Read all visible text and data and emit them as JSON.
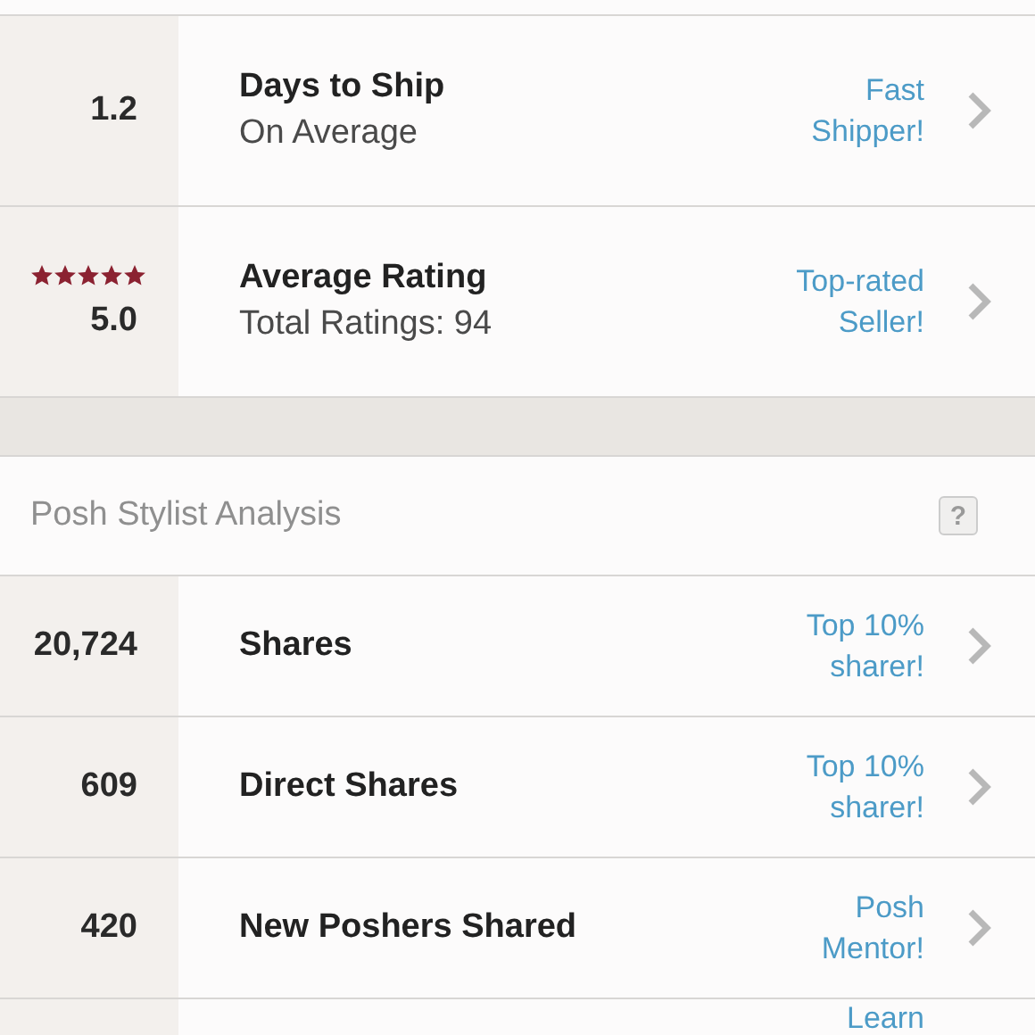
{
  "sections": [
    {
      "kind": "metrics",
      "rows": [
        {
          "value": "1.2",
          "label": "Days to Ship",
          "sublabel": "On Average",
          "badge": [
            "Fast",
            "Shipper!"
          ]
        },
        {
          "value": "5.0",
          "stars": 5,
          "label": "Average Rating",
          "sublabel": "Total Ratings: 94",
          "badge": [
            "Top-rated",
            "Seller!"
          ]
        }
      ]
    },
    {
      "kind": "analysis",
      "title": "Posh Stylist Analysis",
      "help": "?",
      "rows": [
        {
          "value": "20,724",
          "label": "Shares",
          "badge": [
            "Top 10%",
            "sharer!"
          ]
        },
        {
          "value": "609",
          "label": "Direct Shares",
          "badge": [
            "Top 10%",
            "sharer!"
          ]
        },
        {
          "value": "420",
          "label": "New Poshers Shared",
          "badge": [
            "Posh",
            "Mentor!"
          ]
        },
        {
          "badge": [
            "Learn"
          ]
        }
      ]
    }
  ]
}
